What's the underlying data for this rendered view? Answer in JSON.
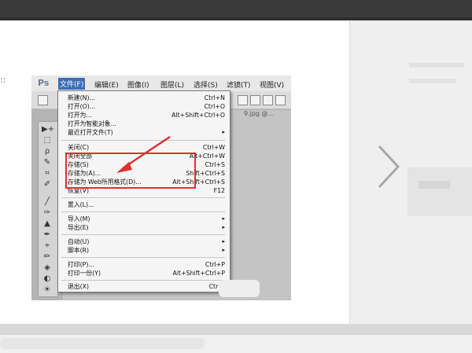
{
  "ps": {
    "logo": "Ps",
    "menus": [
      {
        "label": "文件(F)",
        "active": true
      },
      {
        "label": "编辑(E)"
      },
      {
        "label": "图像(I)"
      },
      {
        "label": "图层(L)"
      },
      {
        "label": "选择(S)"
      },
      {
        "label": "滤镜(T)"
      },
      {
        "label": "视图(V)"
      }
    ],
    "tab_label": "9.jpg @...",
    "file_menu": [
      {
        "label": "新建(N)...",
        "shortcut": "Ctrl+N"
      },
      {
        "label": "打开(O)...",
        "shortcut": "Ctrl+O"
      },
      {
        "label": "打开为...",
        "shortcut": "Alt+Shift+Ctrl+O"
      },
      {
        "label": "打开为智能对象...",
        "shortcut": ""
      },
      {
        "label": "最近打开文件(T)",
        "shortcut": "",
        "submenu": true
      },
      {
        "separator": true
      },
      {
        "label": "关闭(C)",
        "shortcut": "Ctrl+W"
      },
      {
        "label": "关闭全部",
        "shortcut": "Alt+Ctrl+W"
      },
      {
        "label": "存储(S)",
        "shortcut": "Ctrl+S"
      },
      {
        "label": "存储为(A)...",
        "shortcut": "Shift+Ctrl+S"
      },
      {
        "label": "存储为 Web所用格式(D)...",
        "shortcut": "Alt+Shift+Ctrl+S"
      },
      {
        "label": "恢复(V)",
        "shortcut": "F12"
      },
      {
        "separator": true
      },
      {
        "label": "置入(L)...",
        "shortcut": ""
      },
      {
        "separator": true
      },
      {
        "label": "导入(M)",
        "shortcut": "",
        "submenu": true
      },
      {
        "label": "导出(E)",
        "shortcut": "",
        "submenu": true
      },
      {
        "separator": true
      },
      {
        "label": "自动(U)",
        "shortcut": "",
        "submenu": true
      },
      {
        "label": "脚本(R)",
        "shortcut": "",
        "submenu": true
      },
      {
        "separator": true
      },
      {
        "label": "打印(P)...",
        "shortcut": "Ctrl+P"
      },
      {
        "label": "打印一份(Y)",
        "shortcut": "Alt+Shift+Ctrl+P"
      },
      {
        "separator": true
      },
      {
        "label": "退出(X)",
        "shortcut": "Ctrl+"
      }
    ],
    "submenu_arrow": "▸",
    "tool_icons": [
      "▶+",
      "⬚",
      "ρ",
      "✎",
      "⌗",
      "✐",
      "╱",
      "✑",
      "▲",
      "✒",
      "⌖",
      "✏",
      "◈",
      "◐",
      "☀"
    ]
  },
  "nav": {
    "next_icon": "chevron-right-icon",
    "left_marker": "::"
  },
  "colors": {
    "highlight": "#e03030",
    "menu_active": "#3c6db5"
  }
}
